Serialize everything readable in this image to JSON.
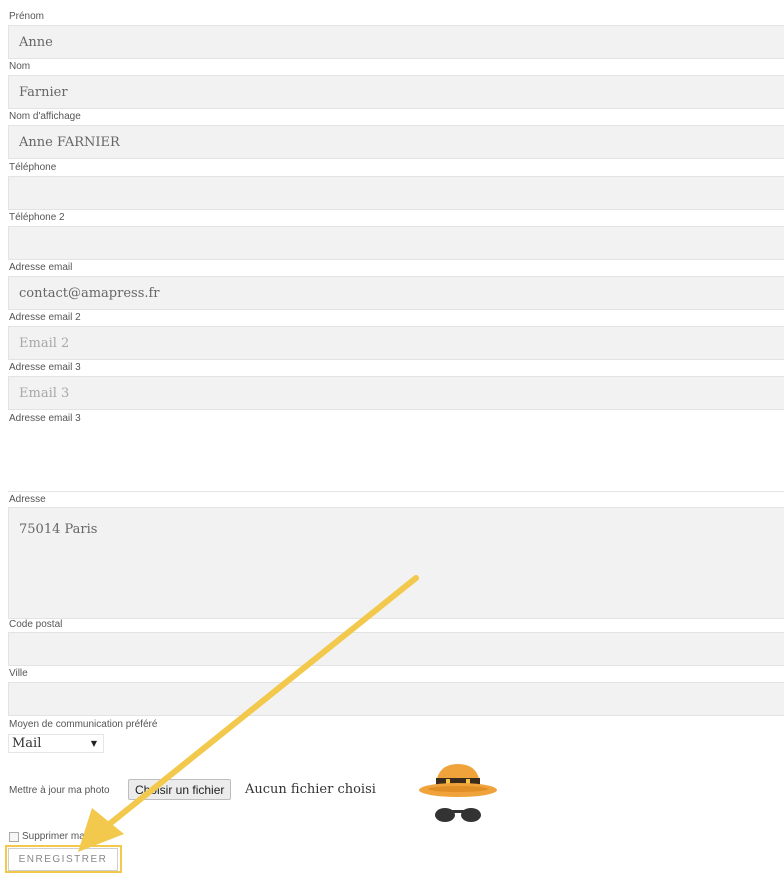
{
  "form": {
    "prenom": {
      "label": "Prénom",
      "value": "Anne"
    },
    "nom": {
      "label": "Nom",
      "value": "Farnier"
    },
    "nom_affichage": {
      "label": "Nom d'affichage",
      "value": "Anne FARNIER"
    },
    "telephone": {
      "label": "Téléphone",
      "value": ""
    },
    "telephone2": {
      "label": "Téléphone 2",
      "value": ""
    },
    "email": {
      "label": "Adresse email",
      "value": "contact@amapress.fr"
    },
    "email2": {
      "label": "Adresse email 2",
      "value": "",
      "placeholder": "Email 2"
    },
    "email3": {
      "label": "Adresse email 3",
      "value": "",
      "placeholder": "Email 3"
    },
    "email3_extra_label": "Adresse email 3",
    "adresse": {
      "label": "Adresse",
      "value": "75014 Paris"
    },
    "code_postal": {
      "label": "Code postal",
      "value": ""
    },
    "ville": {
      "label": "Ville",
      "value": ""
    },
    "moyen_com": {
      "label": "Moyen de communication préféré",
      "selected": "Mail"
    },
    "photo": {
      "label": "Mettre à jour ma photo",
      "button": "Choisir un fichier",
      "status": "Aucun fichier choisi"
    },
    "supprimer_photo": {
      "label": "Supprimer ma photo",
      "checked": false
    },
    "save_label": "ENREGISTRER"
  },
  "annotation": {
    "color": "#f2c94c",
    "target": "save-button"
  }
}
